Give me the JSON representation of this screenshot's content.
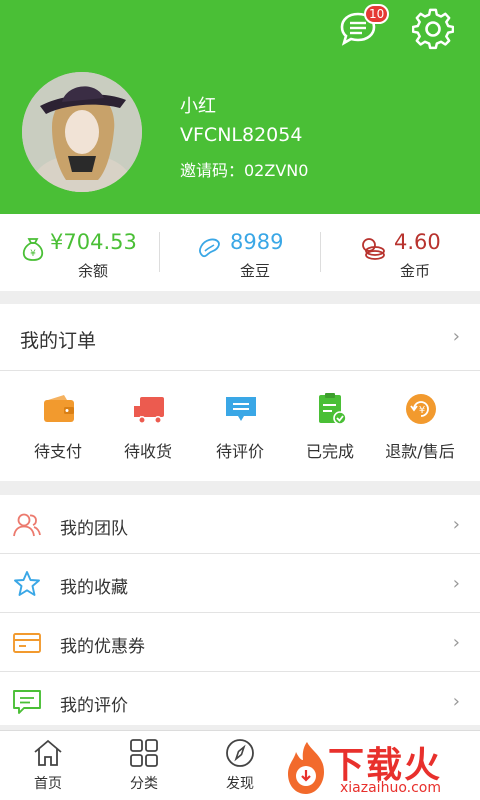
{
  "header": {
    "message_badge": "10",
    "user": {
      "name": "小红",
      "id": "VFCNL82054",
      "invite": "邀请码：02ZVN0"
    }
  },
  "assets": [
    {
      "value": "¥704.53",
      "label": "余额",
      "icon": "money-bag-icon",
      "color": "#4abf36"
    },
    {
      "value": "8989",
      "label": "金豆",
      "icon": "bean-icon",
      "color": "#3aa7e6"
    },
    {
      "value": "4.60",
      "label": "金币",
      "icon": "coins-icon",
      "color": "#b8332e"
    }
  ],
  "orders": {
    "title": "我的订单",
    "chevron": "›",
    "items": [
      {
        "label": "待支付",
        "icon": "wallet-icon",
        "color": "#f29a2e"
      },
      {
        "label": "待收货",
        "icon": "truck-icon",
        "color": "#ec5b4f"
      },
      {
        "label": "待评价",
        "icon": "comment-icon",
        "color": "#3aa7e6"
      },
      {
        "label": "已完成",
        "icon": "clipboard-check-icon",
        "color": "#4abf36"
      },
      {
        "label": "退款/售后",
        "icon": "refund-icon",
        "color": "#f29a2e"
      }
    ]
  },
  "menu": [
    {
      "label": "我的团队",
      "icon": "team-icon",
      "chevron": "›"
    },
    {
      "label": "我的收藏",
      "icon": "star-icon",
      "chevron": "›"
    },
    {
      "label": "我的优惠券",
      "icon": "coupon-icon",
      "chevron": "›"
    },
    {
      "label": "我的评价",
      "icon": "review-icon",
      "chevron": "›"
    }
  ],
  "tabs": [
    {
      "label": "首页",
      "icon": "home-icon"
    },
    {
      "label": "分类",
      "icon": "category-icon"
    },
    {
      "label": "发现",
      "icon": "compass-icon"
    }
  ],
  "watermark": {
    "text": "下载火",
    "sub": "xiazaihuo.com"
  },
  "colors": {
    "brand_green": "#4abf36",
    "blue": "#3aa7e6",
    "red": "#b8332e",
    "orange": "#f29a2e"
  }
}
